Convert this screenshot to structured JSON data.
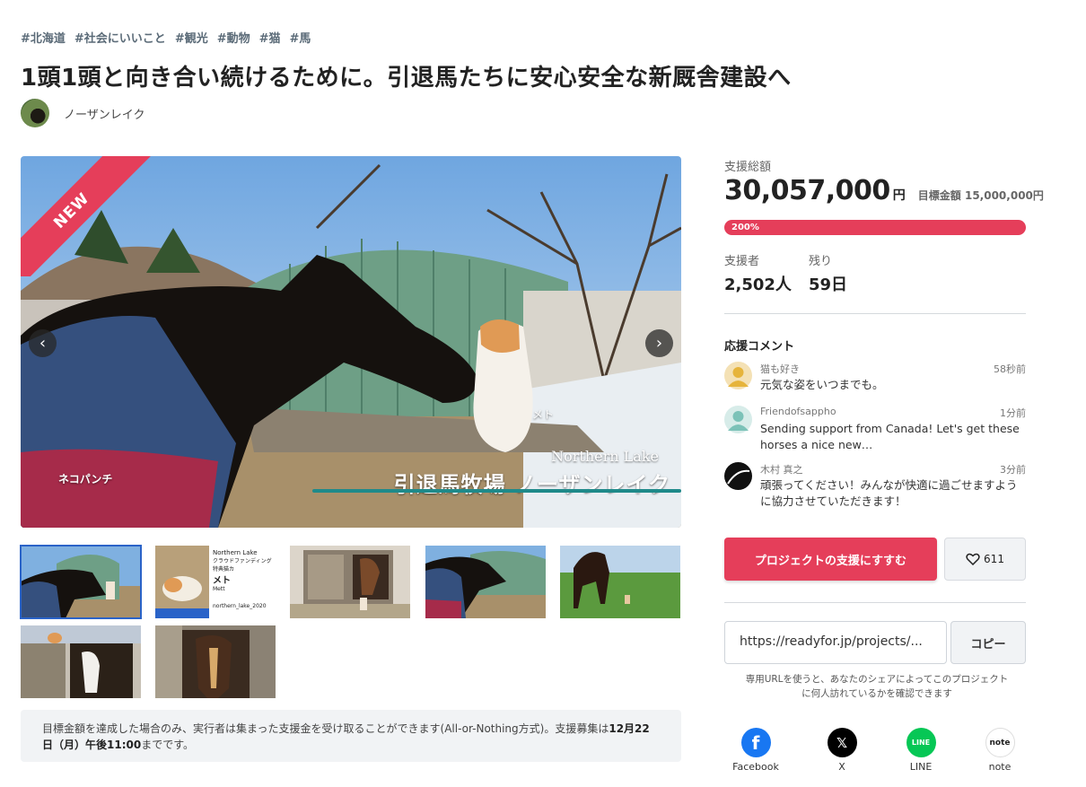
{
  "tags": [
    "#北海道",
    "#社会にいいこと",
    "#観光",
    "#動物",
    "#猫",
    "#馬"
  ],
  "title": "1頭1頭と向き合い続けるために。引退馬たちに安心安全な新厩舎建設へ",
  "owner": {
    "name": "ノーザンレイク"
  },
  "hero": {
    "badge": "NEW",
    "overlay_left": "ネコパンチ",
    "overlay_cat": "メト",
    "overlay_brand_en": "Northern Lake",
    "overlay_brand_jp": "引退馬牧場 ノーザンレイク"
  },
  "thumb2": {
    "title": "Northern Lake",
    "line1": "クラウドファンディング",
    "line2": "特典猫カ",
    "name": "メト",
    "sub": "Mett",
    "ig": "northern_lake_2020"
  },
  "notice": {
    "text": "目標金額を達成した場合のみ、実行者は集まった支援金を受け取ることができます(All-or-Nothing方式)。支援募集は",
    "deadline": "12月22日（月）午後11:00",
    "tail": "までです。"
  },
  "funding": {
    "total_label": "支援総額",
    "total": "30,057,000",
    "currency": "円",
    "goal_label": "目標金額 15,000,000円",
    "percent_text": "200%",
    "progress": 2.0,
    "supporters_label": "支援者",
    "supporters": "2,502人",
    "remaining_label": "残り",
    "remaining": "59日"
  },
  "comments": {
    "heading": "応援コメント",
    "items": [
      {
        "name": "猫も好き",
        "time": "58秒前",
        "text": "元気な姿をいつまでも。"
      },
      {
        "name": "Friendofsappho",
        "time": "1分前",
        "text": "Sending support from Canada! Let's get these horses a nice new…"
      },
      {
        "name": "木村 真之",
        "time": "3分前",
        "text": "頑張ってください！みんなが快適に過ごせますように協力させていただきます！"
      }
    ]
  },
  "actions": {
    "support": "プロジェクトの支援にすすむ",
    "likes": "611"
  },
  "share": {
    "url": "https://readyfor.jp/projects/...",
    "copy": "コピー",
    "note": "専用URLを使うと、あなたのシェアによってこのプロジェクトに何人訪れているかを確認できます",
    "buttons": [
      "Facebook",
      "X",
      "LINE",
      "note"
    ]
  },
  "colors": {
    "accent": "#e53e5a",
    "tag": "#5b6b78",
    "facebook": "#1877f2",
    "line": "#06c755"
  }
}
